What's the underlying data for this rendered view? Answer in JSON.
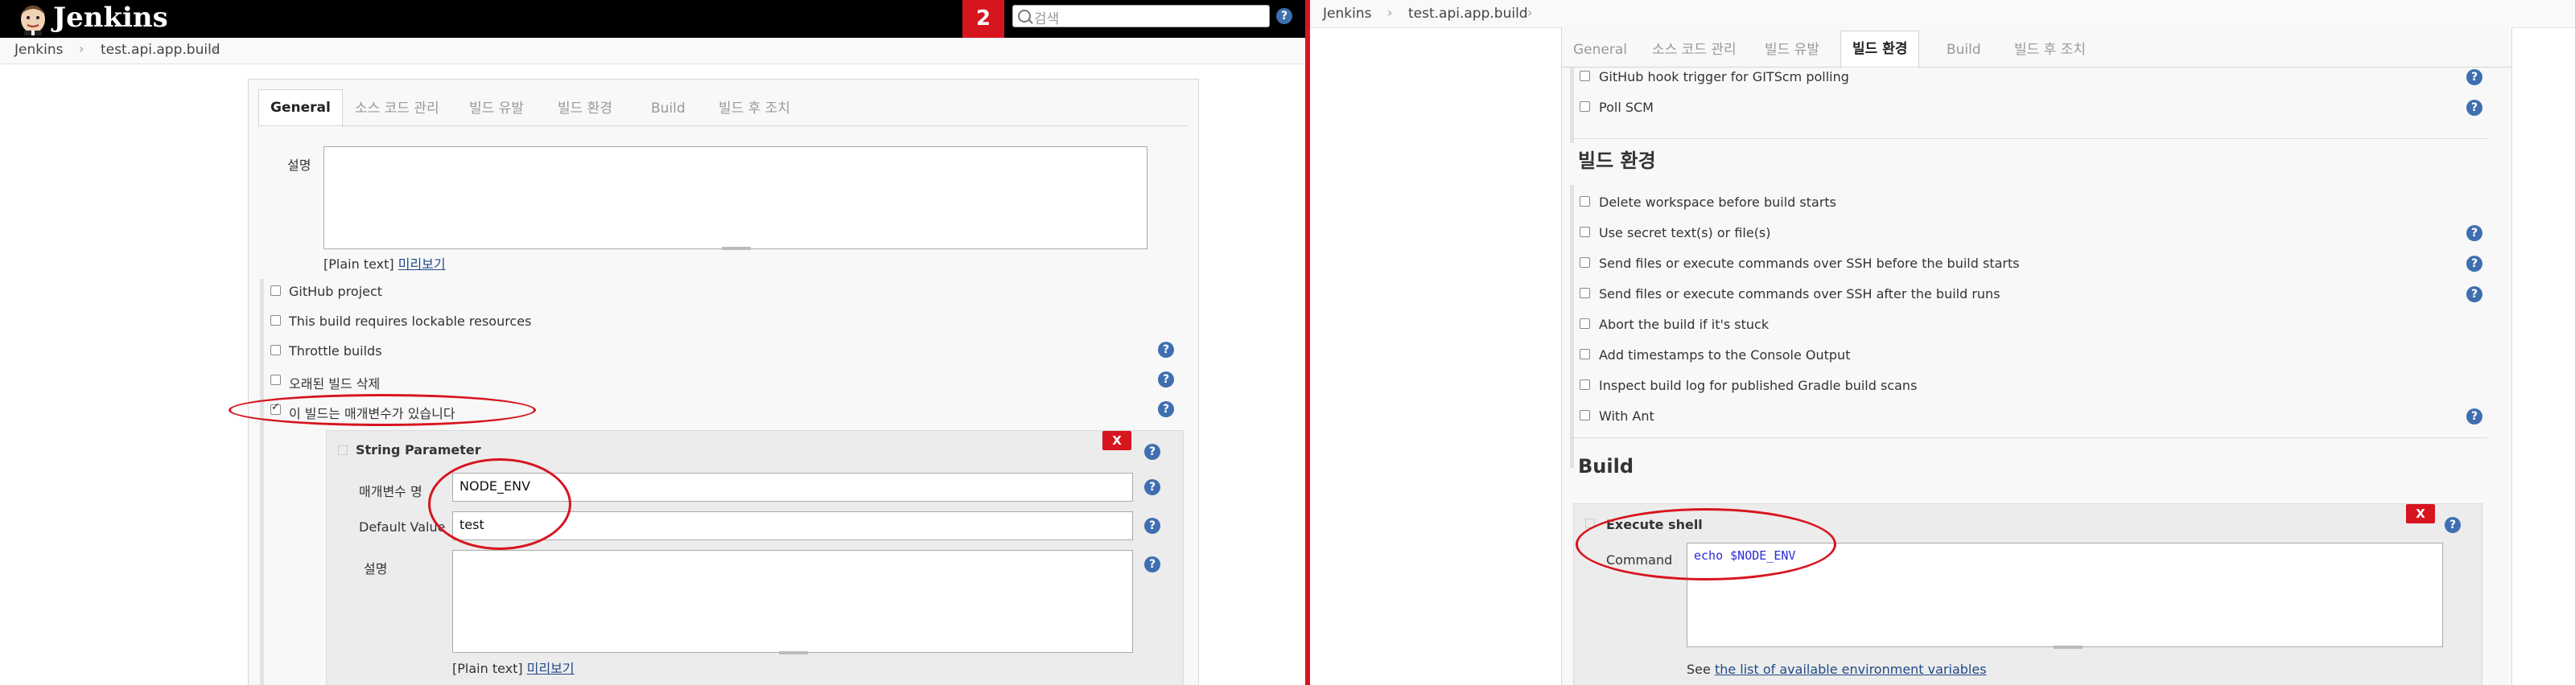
{
  "header": {
    "logo_text": "Jenkins",
    "notification_count": "2",
    "search_placeholder": "검색",
    "help_label": "?"
  },
  "breadcrumbs": [
    "Jenkins",
    "test.api.app.build"
  ],
  "tabs": [
    "General",
    "소스 코드 관리",
    "빌드 유발",
    "빌드 환경",
    "Build",
    "빌드 후 조치"
  ],
  "left": {
    "active_tab": "General",
    "description_label": "설명",
    "plain_text": "[Plain text]",
    "preview_link": "미리보기",
    "options": [
      {
        "label": "GitHub project",
        "checked": false,
        "help": false
      },
      {
        "label": "This build requires lockable resources",
        "checked": false,
        "help": false
      },
      {
        "label": "Throttle builds",
        "checked": false,
        "help": true
      },
      {
        "label": "오래된 빌드 삭제",
        "checked": false,
        "help": true
      },
      {
        "label": "이 빌드는 매개변수가 있습니다",
        "checked": true,
        "help": true
      }
    ],
    "string_param": {
      "title": "String Parameter",
      "delete_label": "X",
      "name_label": "매개변수 명",
      "name_value": "NODE_ENV",
      "default_label": "Default Value",
      "default_value": "test",
      "desc_label": "설명",
      "plain_text": "[Plain text]",
      "preview_link": "미리보기"
    }
  },
  "right": {
    "active_tab": "빌드 환경",
    "trigger_options": [
      {
        "label": "GitHub hook trigger for GITScm polling",
        "checked": false
      },
      {
        "label": "Poll SCM",
        "checked": false
      }
    ],
    "env_section_title": "빌드 환경",
    "env_options": [
      {
        "label": "Delete workspace before build starts",
        "help": false
      },
      {
        "label": "Use secret text(s) or file(s)",
        "help": true
      },
      {
        "label": "Send files or execute commands over SSH before the build starts",
        "help": true
      },
      {
        "label": "Send files or execute commands over SSH after the build runs",
        "help": true
      },
      {
        "label": "Abort the build if it's stuck",
        "help": false
      },
      {
        "label": "Add timestamps to the Console Output",
        "help": false
      },
      {
        "label": "Inspect build log for published Gradle build scans",
        "help": false
      },
      {
        "label": "With Ant",
        "help": true
      }
    ],
    "build_section_title": "Build",
    "exec_shell": {
      "title": "Execute shell",
      "delete_label": "X",
      "command_label": "Command",
      "command_value": "echo $NODE_ENV",
      "see_text": "See",
      "see_link": "the list of available environment variables"
    }
  },
  "colors": {
    "accent_red": "#d7151f",
    "header_bg": "#000000",
    "help_blue": "#3f6fb0",
    "link_blue": "#204a87"
  }
}
